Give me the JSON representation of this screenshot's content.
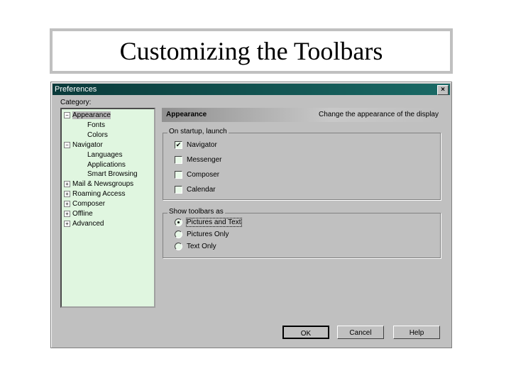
{
  "slide": {
    "title": "Customizing the Toolbars"
  },
  "dialog": {
    "title": "Preferences",
    "close": "×",
    "category_label": "Category:",
    "tree": [
      {
        "label": "Appearance",
        "level": 0,
        "expander": "−",
        "selected": true
      },
      {
        "label": "Fonts",
        "level": 1
      },
      {
        "label": "Colors",
        "level": 1
      },
      {
        "label": "Navigator",
        "level": 0,
        "expander": "−"
      },
      {
        "label": "Languages",
        "level": 1
      },
      {
        "label": "Applications",
        "level": 1
      },
      {
        "label": "Smart Browsing",
        "level": 1
      },
      {
        "label": "Mail & Newsgroups",
        "level": 0,
        "expander": "+"
      },
      {
        "label": "Roaming Access",
        "level": 0,
        "expander": "+"
      },
      {
        "label": "Composer",
        "level": 0,
        "expander": "+"
      },
      {
        "label": "Offline",
        "level": 0,
        "expander": "+"
      },
      {
        "label": "Advanced",
        "level": 0,
        "expander": "+"
      }
    ],
    "panel": {
      "title": "Appearance",
      "description": "Change the appearance of the display",
      "startup": {
        "legend": "On startup, launch",
        "items": [
          {
            "label": "Navigator",
            "checked": true
          },
          {
            "label": "Messenger",
            "checked": false
          },
          {
            "label": "Composer",
            "checked": false
          },
          {
            "label": "Calendar",
            "checked": false
          }
        ]
      },
      "toolbars": {
        "legend": "Show toolbars as",
        "items": [
          {
            "label": "Pictures and Text",
            "selected": true
          },
          {
            "label": "Pictures Only",
            "selected": false
          },
          {
            "label": "Text Only",
            "selected": false
          }
        ]
      }
    },
    "buttons": {
      "ok": "OK",
      "cancel": "Cancel",
      "help": "Help"
    }
  }
}
